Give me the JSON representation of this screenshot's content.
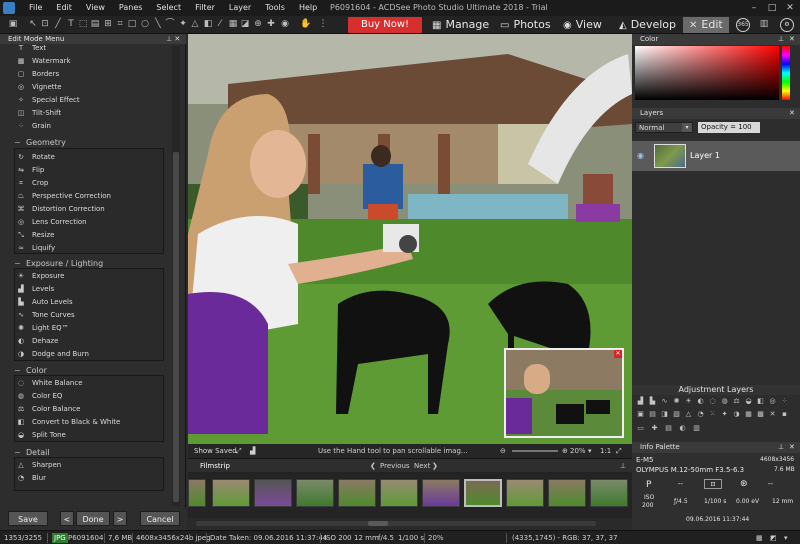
{
  "window": {
    "title": "P6091604 - ACDSee Photo Studio Ultimate 2018 - Trial",
    "menu": [
      "File",
      "Edit",
      "View",
      "Panes",
      "Select",
      "Filter",
      "Layer",
      "Tools",
      "Help"
    ],
    "controls": [
      "–",
      "□",
      "✕"
    ]
  },
  "toolbar": {
    "buy_now": "Buy Now!",
    "modes": {
      "manage": "Manage",
      "photos": "Photos",
      "view": "View",
      "develop": "Develop",
      "edit": "Edit"
    },
    "circle_365": "365"
  },
  "left_panel": {
    "title": "Edit Mode Menu",
    "add_items": [
      "Text",
      "Watermark",
      "Borders",
      "Vignette",
      "Special Effect",
      "Tilt-Shift",
      "Grain"
    ],
    "groups": {
      "geometry": {
        "title": "Geometry",
        "items": [
          "Rotate",
          "Flip",
          "Crop",
          "Perspective Correction",
          "Distortion Correction",
          "Lens Correction",
          "Resize",
          "Liquify"
        ]
      },
      "exposure": {
        "title": "Exposure / Lighting",
        "items": [
          "Exposure",
          "Levels",
          "Auto Levels",
          "Tone Curves",
          "Light EQ™",
          "Dehaze",
          "Dodge and Burn"
        ]
      },
      "color": {
        "title": "Color",
        "items": [
          "White Balance",
          "Color EQ",
          "Color Balance",
          "Convert to Black & White",
          "Split Tone"
        ]
      },
      "detail": {
        "title": "Detail",
        "items": [
          "Sharpen",
          "Blur"
        ]
      }
    },
    "buttons": {
      "save": "Save",
      "done": "Done",
      "cancel": "Cancel",
      "prev": "<",
      "next": ">"
    }
  },
  "view_bar": {
    "show_saved": "Show Saved",
    "hint": "Use the Hand tool to pan scrollable imag...",
    "zoom": "20%",
    "ratio": "1:1"
  },
  "filmstrip": {
    "title": "Filmstrip",
    "previous": "Previous",
    "next": "Next"
  },
  "color_panel": {
    "title": "Color"
  },
  "layers_panel": {
    "title": "Layers",
    "blend_mode": "Normal",
    "opacity": "Opacity = 100",
    "layer_name": "Layer 1"
  },
  "adjustment_layers": {
    "title": "Adjustment Layers"
  },
  "info_palette": {
    "title": "Info Palette",
    "camera_make": "E-M5",
    "resolution": "4608x3456",
    "lens": "OLYMPUS M.12-50mm F3.5-6.3",
    "filesize": "7.6 MB",
    "mode": "P",
    "iso_label": "ISO",
    "iso_value": "200",
    "aperture": "ƒ/4.5",
    "shutter": "1/100 s",
    "exposure_comp": "0.00 eV",
    "focal": "12 mm",
    "placeholders": [
      "--",
      "--",
      "--"
    ],
    "date": "09.06.2016 11:37:44"
  },
  "statusbar": {
    "index": "1353/3255",
    "format": "JPG",
    "filename": "P6091604",
    "size": "7,6 MB",
    "dims": "4608x3456x24b jpeg",
    "date_taken": "Date Taken: 09.06.2016 11:37:44",
    "iso": "ISO 200",
    "focal": "12 mm",
    "aperture": "f/4.5",
    "shutter": "1/100 s",
    "zoom": "20%",
    "rgb": "(4335,1745) - RGB: 37, 37, 37"
  }
}
